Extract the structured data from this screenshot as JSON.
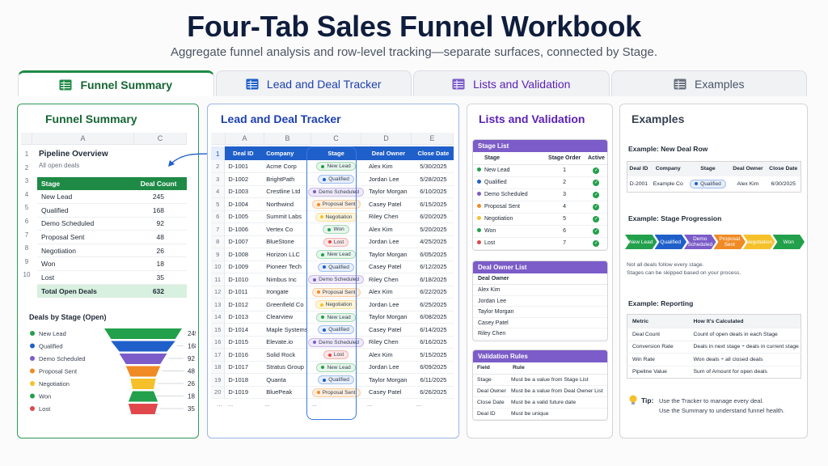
{
  "header": {
    "title": "Four-Tab Sales Funnel Workbook",
    "subtitle": "Aggregate funnel analysis and row-level tracking—separate surfaces, connected by Stage."
  },
  "tabs": [
    {
      "label": "Funnel Summary",
      "icon": "sheet-green-icon"
    },
    {
      "label": "Lead and Deal Tracker",
      "icon": "sheet-blue-icon"
    },
    {
      "label": "Lists and Validation",
      "icon": "sheet-purple-icon"
    },
    {
      "label": "Examples",
      "icon": "sheet-gray-icon"
    }
  ],
  "colors": {
    "green": "#1e8a45",
    "blue": "#1f5fc9",
    "purple": "#7b5cc8",
    "gray": "#6b7280"
  },
  "summary": {
    "title": "Funnel Summary",
    "cols": [
      "A",
      "C"
    ],
    "rows": [
      "1",
      "2",
      "3",
      "4",
      "5",
      "6",
      "7",
      "8",
      "9",
      "10"
    ],
    "pipeline_title": "Pipeline Overview",
    "pipeline_sub": "All open deals",
    "table_head": [
      "Stage",
      "Deal Count"
    ],
    "stages": [
      {
        "name": "New Lead",
        "count": "245"
      },
      {
        "name": "Qualified",
        "count": "168"
      },
      {
        "name": "Demo Scheduled",
        "count": "92"
      },
      {
        "name": "Proposal Sent",
        "count": "48"
      },
      {
        "name": "Negotiation",
        "count": "26"
      },
      {
        "name": "Won",
        "count": "18"
      },
      {
        "name": "Lost",
        "count": "35"
      }
    ],
    "total_label": "Total Open Deals",
    "total_value": "632",
    "chart_title": "Deals by Stage (Open)"
  },
  "chart_data": {
    "type": "bar",
    "title": "Deals by Stage (Open)",
    "categories": [
      "New Lead",
      "Qualified",
      "Demo Scheduled",
      "Proposal Sent",
      "Negotiation",
      "Won",
      "Lost"
    ],
    "values": [
      245,
      168,
      92,
      48,
      26,
      18,
      35
    ],
    "colors": [
      "#22a04b",
      "#1f5fc9",
      "#7b5cc8",
      "#f08a24",
      "#f5c02a",
      "#22a04b",
      "#e0484b"
    ],
    "legend": "left"
  },
  "tracker": {
    "title": "Lead and Deal Tracker",
    "col_letters": [
      "A",
      "B",
      "C",
      "D",
      "E"
    ],
    "headers": [
      "Deal ID",
      "Company",
      "Stage",
      "Deal Owner",
      "Close Date"
    ],
    "rows": [
      {
        "n": "2",
        "id": "D-1001",
        "company": "Acme Corp",
        "stage": "New Lead",
        "owner": "Alex Kim",
        "date": "5/30/2025"
      },
      {
        "n": "3",
        "id": "D-1002",
        "company": "BrightPath",
        "stage": "Qualified",
        "owner": "Jordan Lee",
        "date": "5/28/2025"
      },
      {
        "n": "4",
        "id": "D-1003",
        "company": "Crestline Ltd",
        "stage": "Demo Scheduled",
        "owner": "Taylor Morgan",
        "date": "6/10/2025"
      },
      {
        "n": "5",
        "id": "D-1004",
        "company": "Northwind",
        "stage": "Proposal Sent",
        "owner": "Casey Patel",
        "date": "6/15/2025"
      },
      {
        "n": "6",
        "id": "D-1005",
        "company": "Summit Labs",
        "stage": "Negotiation",
        "owner": "Riley Chen",
        "date": "6/20/2025"
      },
      {
        "n": "7",
        "id": "D-1006",
        "company": "Vertex Co",
        "stage": "Won",
        "owner": "Alex Kim",
        "date": "5/20/2025"
      },
      {
        "n": "8",
        "id": "D-1007",
        "company": "BlueStone",
        "stage": "Lost",
        "owner": "Jordan Lee",
        "date": "4/25/2025"
      },
      {
        "n": "9",
        "id": "D-1008",
        "company": "Horizon LLC",
        "stage": "New Lead",
        "owner": "Taylor Morgan",
        "date": "6/05/2025"
      },
      {
        "n": "10",
        "id": "D-1009",
        "company": "Pioneer Tech",
        "stage": "Qualified",
        "owner": "Casey Patel",
        "date": "6/12/2025"
      },
      {
        "n": "11",
        "id": "D-1010",
        "company": "Nimbus Inc",
        "stage": "Demo Scheduled",
        "owner": "Riley Chen",
        "date": "6/18/2025"
      },
      {
        "n": "12",
        "id": "D-1011",
        "company": "Irongate",
        "stage": "Proposal Sent",
        "owner": "Alex Kim",
        "date": "6/22/2025"
      },
      {
        "n": "13",
        "id": "D-1012",
        "company": "Greenfield Co",
        "stage": "Negotiation",
        "owner": "Jordan Lee",
        "date": "6/25/2025"
      },
      {
        "n": "14",
        "id": "D-1013",
        "company": "Clearview",
        "stage": "New Lead",
        "owner": "Taylor Morgan",
        "date": "6/08/2025"
      },
      {
        "n": "15",
        "id": "D-1014",
        "company": "Maple Systems",
        "stage": "Qualified",
        "owner": "Casey Patel",
        "date": "6/14/2025"
      },
      {
        "n": "16",
        "id": "D-1015",
        "company": "Elevate.io",
        "stage": "Demo Scheduled",
        "owner": "Riley Chen",
        "date": "6/16/2025"
      },
      {
        "n": "17",
        "id": "D-1016",
        "company": "Solid Rock",
        "stage": "Lost",
        "owner": "Alex Kim",
        "date": "5/15/2025"
      },
      {
        "n": "18",
        "id": "D-1017",
        "company": "Stratus Group",
        "stage": "New Lead",
        "owner": "Jordan Lee",
        "date": "6/09/2025"
      },
      {
        "n": "19",
        "id": "D-1018",
        "company": "Quanta",
        "stage": "Qualified",
        "owner": "Taylor Morgan",
        "date": "6/11/2025"
      },
      {
        "n": "20",
        "id": "D-1019",
        "company": "BluePeak",
        "stage": "Proposal Sent",
        "owner": "Casey Patel",
        "date": "6/26/2025"
      }
    ],
    "ellipsis": "..."
  },
  "lists": {
    "title": "Lists and Validation",
    "stage_list": {
      "title": "Stage List",
      "headers": [
        "Stage",
        "Stage Order",
        "Active"
      ],
      "rows": [
        [
          "New Lead",
          "1"
        ],
        [
          "Qualified",
          "2"
        ],
        [
          "Demo Scheduled",
          "3"
        ],
        [
          "Proposal Sent",
          "4"
        ],
        [
          "Negotiation",
          "5"
        ],
        [
          "Won",
          "6"
        ],
        [
          "Lost",
          "7"
        ]
      ]
    },
    "owner_list": {
      "title": "Deal Owner List",
      "header": "Deal Owner",
      "rows": [
        "Alex Kim",
        "Jordan Lee",
        "Taylor Morgan",
        "Casey Patel",
        "Riley Chen"
      ]
    },
    "rules": {
      "title": "Validation Rules",
      "headers": [
        "Field",
        "Rule"
      ],
      "rows": [
        [
          "Stage",
          "Must be a value from Stage List"
        ],
        [
          "Deal Owner",
          "Must be a value from Deal Owner List"
        ],
        [
          "Close Date",
          "Must be a valid future date"
        ],
        [
          "Deal ID",
          "Must be unique"
        ]
      ]
    }
  },
  "examples": {
    "title": "Examples",
    "new_row": {
      "title": "Example: New Deal Row",
      "headers": [
        "Deal ID",
        "Company",
        "Stage",
        "Deal Owner",
        "Close Date"
      ],
      "row": [
        "D-2001",
        "Example Co",
        "Qualified",
        "Alex Kim",
        "6/30/2025"
      ]
    },
    "progression": {
      "title": "Example: Stage Progression",
      "steps": [
        "New Lead",
        "Qualified",
        "Demo Scheduled",
        "Proposal Sent",
        "Negotiation",
        "Won"
      ],
      "note1": "Not all deals follow every stage.",
      "note2": "Stages can be skipped based on your process."
    },
    "reporting": {
      "title": "Example: Reporting",
      "headers": [
        "Metric",
        "How It's Calculated"
      ],
      "rows": [
        [
          "Deal Count",
          "Count of open deals in each Stage"
        ],
        [
          "Conversion Rate",
          "Deals in next stage ÷ deals in current stage"
        ],
        [
          "Win Rate",
          "Won deals ÷ all closed deals"
        ],
        [
          "Pipeline Value",
          "Sum of Amount for open deals"
        ]
      ]
    },
    "tip_label": "Tip:",
    "tip1": "Use the Tracker to manage every deal.",
    "tip2": "Use the Summary to understand funnel health."
  }
}
